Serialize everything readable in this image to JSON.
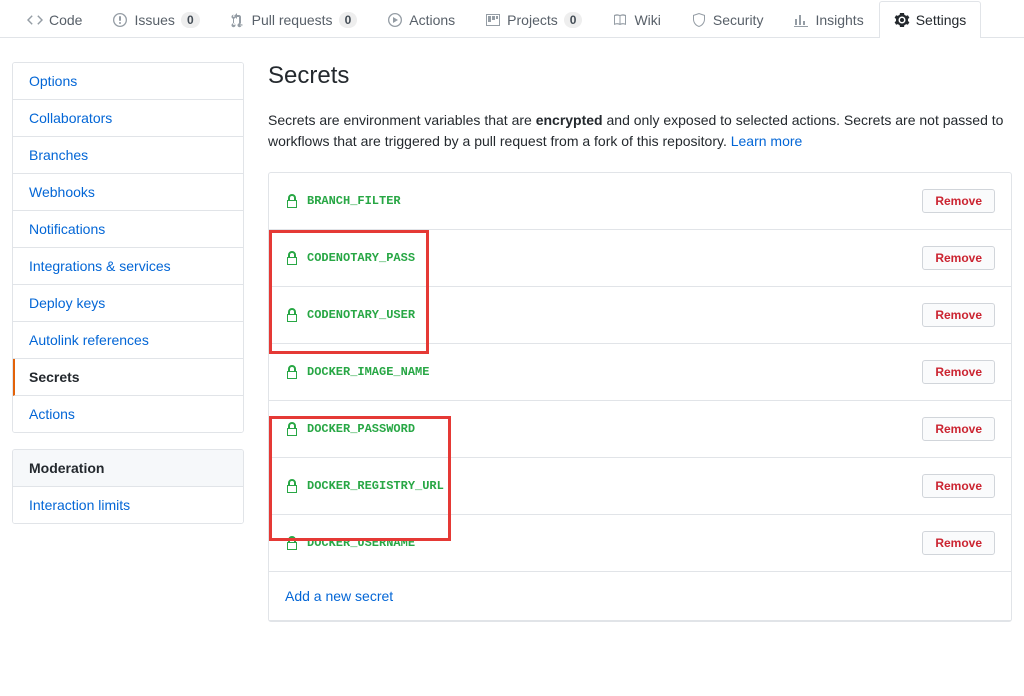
{
  "repo_nav": {
    "code": "Code",
    "issues": "Issues",
    "issues_count": "0",
    "pulls": "Pull requests",
    "pulls_count": "0",
    "actions": "Actions",
    "projects": "Projects",
    "projects_count": "0",
    "wiki": "Wiki",
    "security": "Security",
    "insights": "Insights",
    "settings": "Settings"
  },
  "sidebar": {
    "items": [
      "Options",
      "Collaborators",
      "Branches",
      "Webhooks",
      "Notifications",
      "Integrations & services",
      "Deploy keys",
      "Autolink references",
      "Secrets",
      "Actions"
    ],
    "moderation_header": "Moderation",
    "moderation_items": [
      "Interaction limits"
    ]
  },
  "page": {
    "title": "Secrets",
    "desc_prefix": "Secrets are environment variables that are ",
    "desc_bold": "encrypted",
    "desc_suffix": " and only exposed to selected actions. Secrets are not passed to workflows that are triggered by a pull request from a fork of this repository. ",
    "desc_link": "Learn more"
  },
  "secrets": [
    {
      "name": "BRANCH_FILTER"
    },
    {
      "name": "CODENOTARY_PASS"
    },
    {
      "name": "CODENOTARY_USER"
    },
    {
      "name": "DOCKER_IMAGE_NAME"
    },
    {
      "name": "DOCKER_PASSWORD"
    },
    {
      "name": "DOCKER_REGISTRY_URL"
    },
    {
      "name": "DOCKER_USERNAME"
    }
  ],
  "labels": {
    "remove": "Remove",
    "add_secret": "Add a new secret"
  }
}
